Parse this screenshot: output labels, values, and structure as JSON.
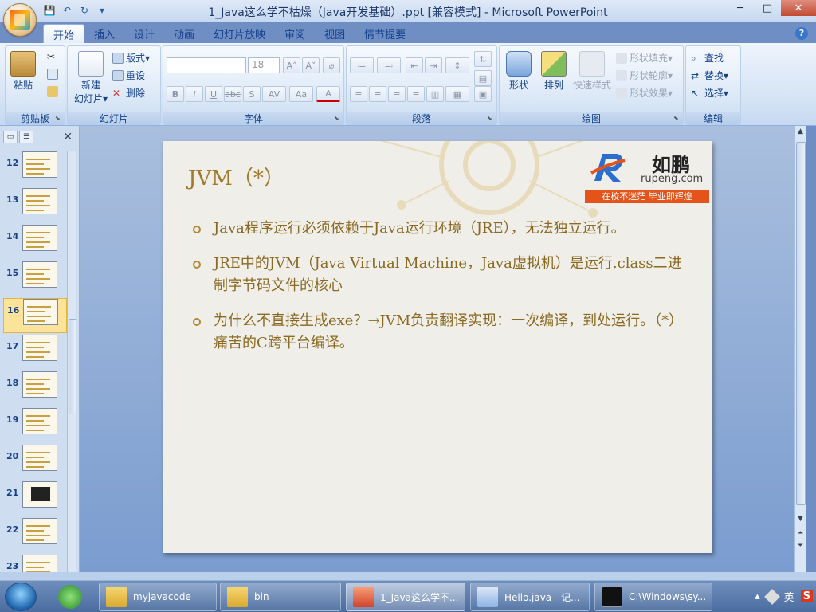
{
  "window": {
    "title": "1_Java这么学不枯燥（Java开发基础）.ppt [兼容模式] - Microsoft PowerPoint",
    "controls": {
      "minimize": "─",
      "maximize": "□",
      "close": "✕"
    }
  },
  "qat": {
    "save": "💾",
    "undo": "↶",
    "redo": "↻",
    "more": "▾"
  },
  "tabs": [
    "开始",
    "插入",
    "设计",
    "动画",
    "幻灯片放映",
    "审阅",
    "视图",
    "情节提要"
  ],
  "active_tab": 0,
  "help": "?",
  "ribbon": {
    "clipboard": {
      "label": "剪贴板",
      "paste": "粘贴"
    },
    "slides": {
      "label": "幻灯片",
      "new_slide": "新建",
      "new_slide2": "幻灯片▾",
      "layout": "版式▾",
      "reset": "重设",
      "delete": "删除"
    },
    "font": {
      "label": "字体",
      "font_name": "",
      "font_size": "18",
      "bold": "B",
      "italic": "I",
      "underline": "U",
      "strike": "abc",
      "shadow": "S",
      "spacing": "AV",
      "case": "Aa",
      "color": "A",
      "grow": "A˄",
      "shrink": "A˅",
      "clear": "⌀"
    },
    "paragraph": {
      "label": "段落"
    },
    "drawing": {
      "label": "绘图",
      "shapes": "形状",
      "arrange": "排列",
      "quick_styles": "快速样式",
      "shape_fill": "形状填充▾",
      "shape_outline": "形状轮廓▾",
      "shape_effect": "形状效果▾"
    },
    "editing": {
      "label": "编辑",
      "find": "查找",
      "replace": "替换▾",
      "select": "选择▾"
    }
  },
  "slide_pane": {
    "thumbnails": [
      {
        "num": "12",
        "dark": false
      },
      {
        "num": "13",
        "dark": false
      },
      {
        "num": "14",
        "dark": false
      },
      {
        "num": "15",
        "dark": false
      },
      {
        "num": "16",
        "dark": false,
        "selected": true
      },
      {
        "num": "17",
        "dark": false
      },
      {
        "num": "18",
        "dark": false
      },
      {
        "num": "19",
        "dark": false
      },
      {
        "num": "20",
        "dark": false
      },
      {
        "num": "21",
        "dark": true
      },
      {
        "num": "22",
        "dark": false
      },
      {
        "num": "23",
        "dark": false
      }
    ]
  },
  "slide": {
    "title": "JVM（*）",
    "logo": {
      "cn": "如鹏",
      "en": "rupeng.com",
      "banner": "在校不迷茫  毕业即辉煌"
    },
    "bullets": [
      "Java程序运行必须依赖于Java运行环境（JRE），无法独立运行。",
      "JRE中的JVM（Java Virtual Machine，Java虚拟机）是运行.class二进制字节码文件的核心",
      "为什么不直接生成exe？→JVM负责翻译实现：一次编译，到处运行。（*）痛苦的C跨平台编译。"
    ]
  },
  "taskbar": {
    "buttons": [
      {
        "label": "myjavacode"
      },
      {
        "label": "bin"
      },
      {
        "label": "1_Java这么学不..."
      },
      {
        "label": "Hello.java - 记..."
      },
      {
        "label": "C:\\Windows\\sy..."
      }
    ],
    "tray": {
      "arrow": "▴",
      "ime": "英",
      "s": "S"
    }
  },
  "colors": {
    "accent": "#15428b",
    "slide_text": "#8a6a22",
    "title": "#9e7a2a",
    "banner": "#e3531a"
  }
}
